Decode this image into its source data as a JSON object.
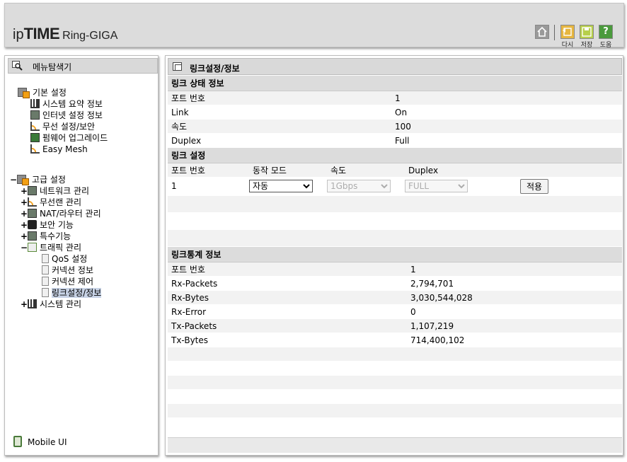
{
  "header": {
    "logo_ip": "ip",
    "logo_time": "TIME",
    "logo_model": "Ring-GIGA",
    "buttons": {
      "back": "다시",
      "save": "저장",
      "help": "도움"
    },
    "help_glyph": "?"
  },
  "sidebar": {
    "title": "메뉴탐색기",
    "basic": {
      "label": "기본 설정",
      "items": [
        "시스템 요약 정보",
        "인터넷 설정 정보",
        "무선 설정/보안",
        "펌웨어 업그레이드",
        "Easy Mesh"
      ]
    },
    "advanced": {
      "label": "고급 설정",
      "expander": "−",
      "items": [
        {
          "label": "네트워크 관리",
          "expander": "+"
        },
        {
          "label": "무선랜 관리",
          "expander": "+"
        },
        {
          "label": "NAT/라우터 관리",
          "expander": "+"
        },
        {
          "label": "보안 기능",
          "expander": "+"
        },
        {
          "label": "특수기능",
          "expander": "+"
        },
        {
          "label": "트래픽 관리",
          "expander": "−"
        }
      ],
      "traffic_children": [
        "QoS 설정",
        "커넥션 정보",
        "커넥션 제어",
        "링크설정/정보"
      ],
      "system": {
        "label": "시스템 관리",
        "expander": "+"
      }
    },
    "mobile": "Mobile UI"
  },
  "main": {
    "title": "링크설정/정보",
    "status": {
      "title": "링크 상태 정보",
      "rows": [
        {
          "label": "포트 번호",
          "value": "1"
        },
        {
          "label": "Link",
          "value": "On"
        },
        {
          "label": "속도",
          "value": "100"
        },
        {
          "label": "Duplex",
          "value": "Full"
        }
      ]
    },
    "settings": {
      "title": "링크 설정",
      "headers": {
        "port": "포트 번호",
        "mode": "동작 모드",
        "speed": "속도",
        "duplex": "Duplex"
      },
      "port": "1",
      "mode": "자동",
      "speed": "1Gbps",
      "duplex": "FULL",
      "apply": "적용"
    },
    "stats": {
      "title": "링크통계 정보",
      "rows": [
        {
          "label": "포트 번호",
          "value": "1"
        },
        {
          "label": "Rx-Packets",
          "value": "2,794,701"
        },
        {
          "label": "Rx-Bytes",
          "value": "3,030,544,028"
        },
        {
          "label": "Rx-Error",
          "value": "0"
        },
        {
          "label": "Tx-Packets",
          "value": "1,107,219"
        },
        {
          "label": "Tx-Bytes",
          "value": "714,400,102"
        }
      ]
    }
  }
}
